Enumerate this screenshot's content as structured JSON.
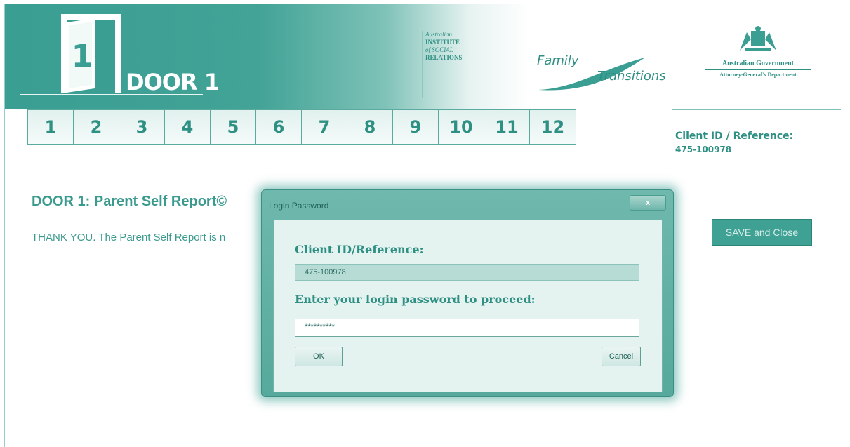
{
  "header": {
    "door_number": "1",
    "title": "DOOR 1",
    "partners": {
      "aisr": [
        "Australian",
        "INSTITUTE",
        "of SOCIAL",
        "RELATIONS"
      ],
      "family_transitions": [
        "Family",
        "Transitions"
      ],
      "gov": [
        "Australian Government",
        "Attorney-General's Department"
      ]
    }
  },
  "step_tabs": [
    "1",
    "2",
    "3",
    "4",
    "5",
    "6",
    "7",
    "8",
    "9",
    "10",
    "11",
    "12"
  ],
  "sidebar": {
    "client_label": "Client ID / Reference:",
    "client_value": "475-100978",
    "save_button": "SAVE and Close"
  },
  "main": {
    "heading": "DOOR 1: Parent Self Report©",
    "text": "THANK YOU. The Parent Self Report is n"
  },
  "dialog": {
    "title": "Login Password",
    "close_label": "x",
    "client_label": "Client ID/Reference:",
    "client_value": "475-100978",
    "password_label": "Enter your login  password to proceed:",
    "password_value": "**********",
    "ok_label": "OK",
    "cancel_label": "Cancel"
  },
  "colors": {
    "accent": "#3a9e93",
    "text": "#2e8f83",
    "dialog_bg": "#e4f2f0"
  }
}
